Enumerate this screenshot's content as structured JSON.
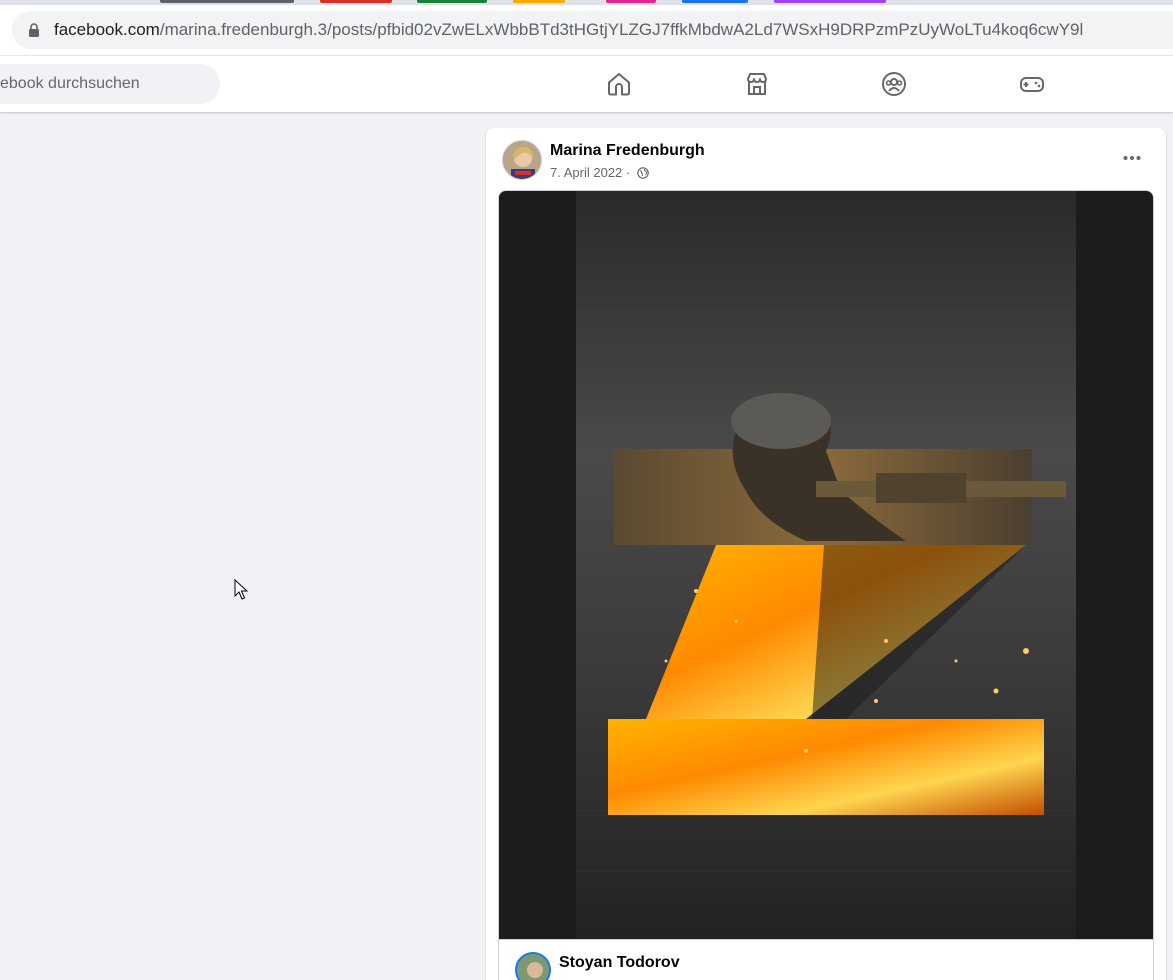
{
  "browser": {
    "url_domain": "facebook.com",
    "url_path": "/marina.fredenburgh.3/posts/pfbid02vZwELxWbbBTd3tHGtjYLZGJ7ffkMbdwA2Ld7WSxH9DRPzmPzUyWoLTu4koq6cwY9l",
    "tab_colors": [
      "#5f6368",
      "#d93025",
      "#188038",
      "#f9ab00",
      "#e52592",
      "#1a73e8",
      "#a142f4"
    ]
  },
  "header": {
    "search_placeholder": "ebook durchsuchen",
    "nav_icons": [
      "home-icon",
      "marketplace-icon",
      "groups-icon",
      "gaming-icon"
    ]
  },
  "post": {
    "author": "Marina Fredenburgh",
    "date": "7. April 2022 ·",
    "privacy_icon": "globe-icon",
    "menu_icon": "more-options-icon",
    "image_icon": "z-symbol-soldier-flames-image",
    "comment": {
      "author": "Stoyan Todorov"
    }
  },
  "colors": {
    "fb_background": "#f0f2f5",
    "fb_blue": "#1877f2"
  }
}
